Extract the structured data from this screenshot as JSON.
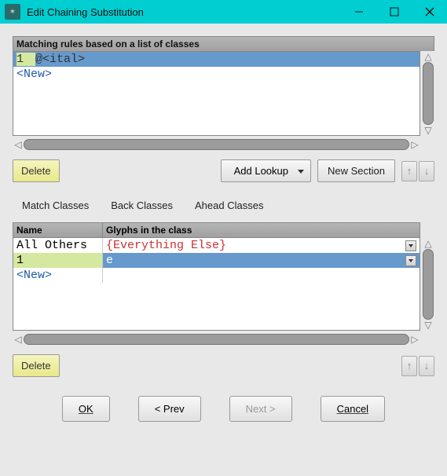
{
  "window": {
    "title": "Edit Chaining Substitution"
  },
  "rules": {
    "header": "Matching rules based on a list of classes",
    "items": [
      {
        "text": "1 @<ital>",
        "selected": true,
        "is_new": false
      },
      {
        "text": "<New>",
        "selected": false,
        "is_new": true
      }
    ]
  },
  "toolbar1": {
    "delete": "Delete",
    "add_lookup": "Add Lookup",
    "new_section": "New Section"
  },
  "tabs": {
    "match": "Match Classes",
    "back": "Back Classes",
    "ahead": "Ahead Classes"
  },
  "table": {
    "col_name": "Name",
    "col_glyphs": "Glyphs in the class",
    "rows": [
      {
        "name": "All Others",
        "glyphs": "{Everything Else}",
        "special": true,
        "selected": false,
        "is_new": false
      },
      {
        "name": "1",
        "glyphs": "e",
        "special": false,
        "selected": true,
        "is_new": false
      },
      {
        "name": "<New>",
        "glyphs": "",
        "special": false,
        "selected": false,
        "is_new": true
      }
    ]
  },
  "toolbar2": {
    "delete": "Delete"
  },
  "footer": {
    "ok": "OK",
    "prev": "< Prev",
    "next": "Next >",
    "cancel": "Cancel"
  }
}
